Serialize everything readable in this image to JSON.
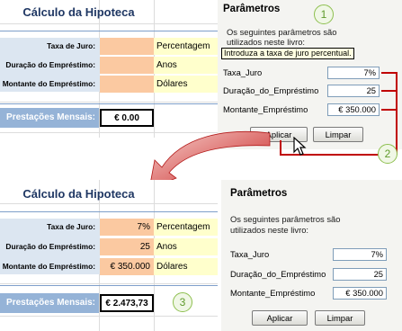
{
  "top": {
    "sheet": {
      "title": "Cálculo da Hipoteca",
      "rows": [
        {
          "label": "Taxa de Juro:",
          "value": "",
          "unit": "Percentagem"
        },
        {
          "label": "Duração do Empréstimo:",
          "value": "",
          "unit": "Anos"
        },
        {
          "label": "Montante do Empréstimo:",
          "value": "",
          "unit": "Dólares"
        }
      ],
      "payment_label": "Prestações Mensais:",
      "payment_value": "€ 0.00"
    },
    "panel": {
      "title": "Parâmetros",
      "description_1": "Os seguintes parâmetros são",
      "description_2": "utilizados neste livro:",
      "tooltip": "Introduza a taxa de juro percentual.",
      "params": [
        {
          "name": "Taxa_Juro",
          "value": "7%"
        },
        {
          "name": "Duração_do_Empréstimo",
          "value": "25"
        },
        {
          "name": "Montante_Empréstimo",
          "value": "€ 350.000"
        }
      ],
      "apply_label": "Aplicar",
      "clear_label": "Limpar"
    },
    "badges": {
      "one": "1",
      "two": "2"
    }
  },
  "bottom": {
    "sheet": {
      "title": "Cálculo da Hipoteca",
      "rows": [
        {
          "label": "Taxa de Juro:",
          "value": "7%",
          "unit": "Percentagem"
        },
        {
          "label": "Duração do Empréstimo:",
          "value": "25",
          "unit": "Anos"
        },
        {
          "label": "Montante do Empréstimo:",
          "value": "€ 350.000",
          "unit": "Dólares"
        }
      ],
      "payment_label": "Prestações Mensais:",
      "payment_value": "€ 2.473,73"
    },
    "panel": {
      "title": "Parâmetros",
      "description_1": "Os seguintes parâmetros são",
      "description_2": "utilizados neste livro:",
      "params": [
        {
          "name": "Taxa_Juro",
          "value": "7%"
        },
        {
          "name": "Duração_do_Empréstimo",
          "value": "25"
        },
        {
          "name": "Montante_Empréstimo",
          "value": "€ 350.000"
        }
      ],
      "apply_label": "Aplicar",
      "clear_label": "Limpar"
    },
    "badges": {
      "three": "3"
    }
  },
  "colors": {
    "title_blue": "#1f3763",
    "input_orange": "#fbc9a1",
    "unit_yellow": "#ffffcc",
    "label_shade": "#dce6f1",
    "payment_header": "#95b3d7",
    "annotation_red": "#c00000",
    "badge_green": "#8dbf4e"
  }
}
